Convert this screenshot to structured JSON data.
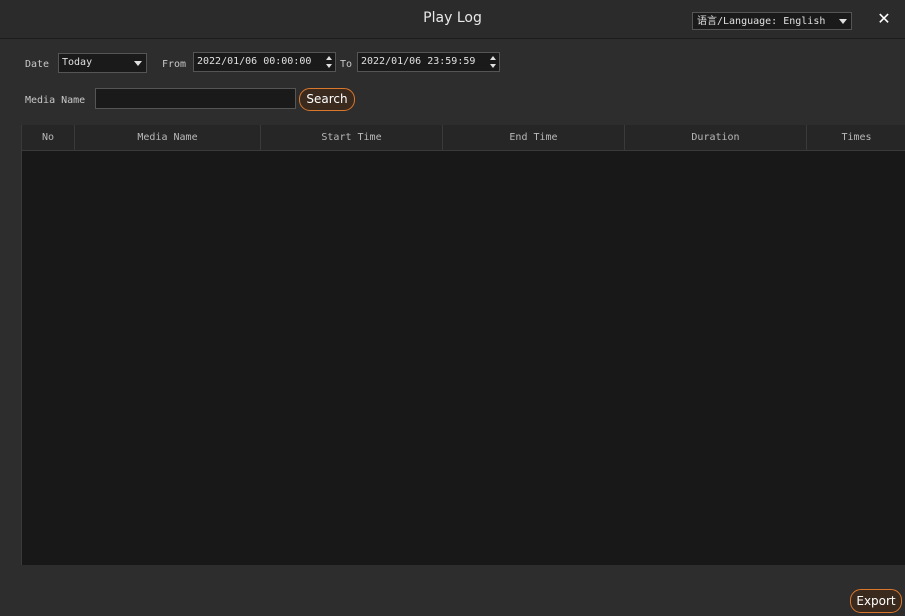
{
  "window": {
    "title": "Play Log",
    "language_label": "语言/Language: English",
    "close_symbol": "✕"
  },
  "filters": {
    "date_label": "Date",
    "date_value": "Today",
    "from_label": "From",
    "from_value": "2022/01/06 00:00:00",
    "to_label": "To",
    "to_value": "2022/01/06 23:59:59",
    "media_name_label": "Media Name",
    "media_name_value": "",
    "search_button": "Search"
  },
  "table": {
    "columns": [
      "No",
      "Media Name",
      "Start Time",
      "End Time",
      "Duration",
      "Times"
    ],
    "rows": []
  },
  "footer": {
    "export_button": "Export"
  },
  "colors": {
    "accent": "#d9772c",
    "background": "#2d2d2d",
    "table_background": "#181818"
  }
}
